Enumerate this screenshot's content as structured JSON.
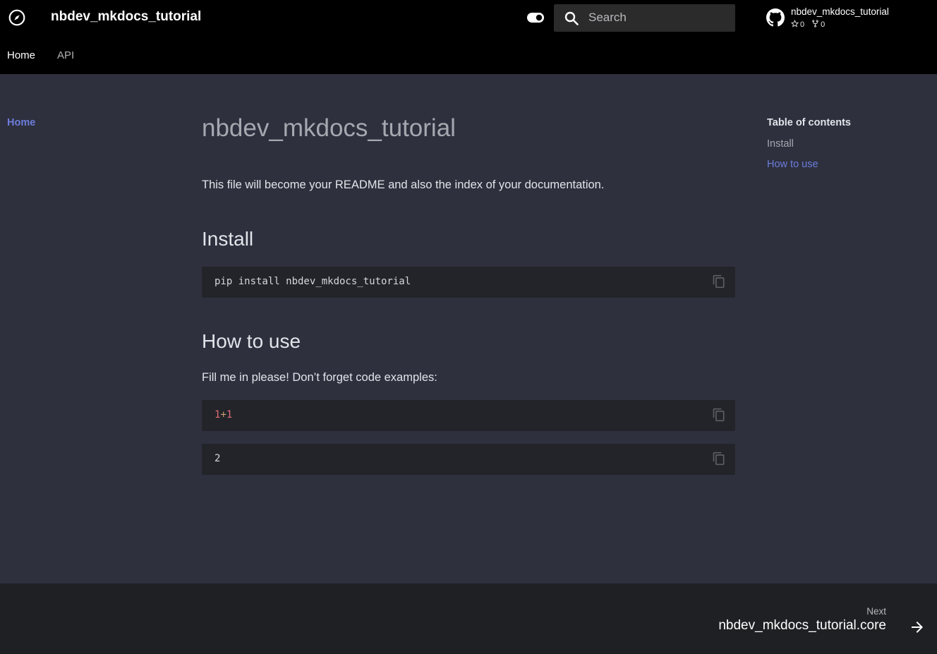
{
  "header": {
    "site_title": "nbdev_mkdocs_tutorial",
    "logo_icon": "compass-icon",
    "search": {
      "placeholder": "Search"
    },
    "repo": {
      "name": "nbdev_mkdocs_tutorial",
      "stars": "0",
      "forks": "0"
    }
  },
  "tabs": [
    {
      "label": "Home",
      "active": true
    },
    {
      "label": "API",
      "active": false
    }
  ],
  "sidebar": {
    "items": [
      {
        "label": "Home"
      }
    ]
  },
  "content": {
    "title": "nbdev_mkdocs_tutorial",
    "intro": "This file will become your README and also the index of your documentation.",
    "sections": [
      {
        "heading": "Install",
        "code": "pip install nbdev_mkdocs_tutorial"
      },
      {
        "heading": "How to use",
        "paragraph": "Fill me in please! Don’t forget code examples:",
        "code_parts": [
          "1",
          "+",
          "1"
        ],
        "output": "2"
      }
    ]
  },
  "toc": {
    "title": "Table of contents",
    "items": [
      {
        "label": "Install",
        "active": false
      },
      {
        "label": "How to use",
        "active": true
      }
    ]
  },
  "footer": {
    "next_label": "Next",
    "next_title": "nbdev_mkdocs_tutorial.core"
  },
  "colors": {
    "accent": "#6d7ddb",
    "header_bg": "#000000",
    "page_bg": "#2e303e",
    "code_bg": "#232429",
    "footer_bg": "#1f2024"
  }
}
